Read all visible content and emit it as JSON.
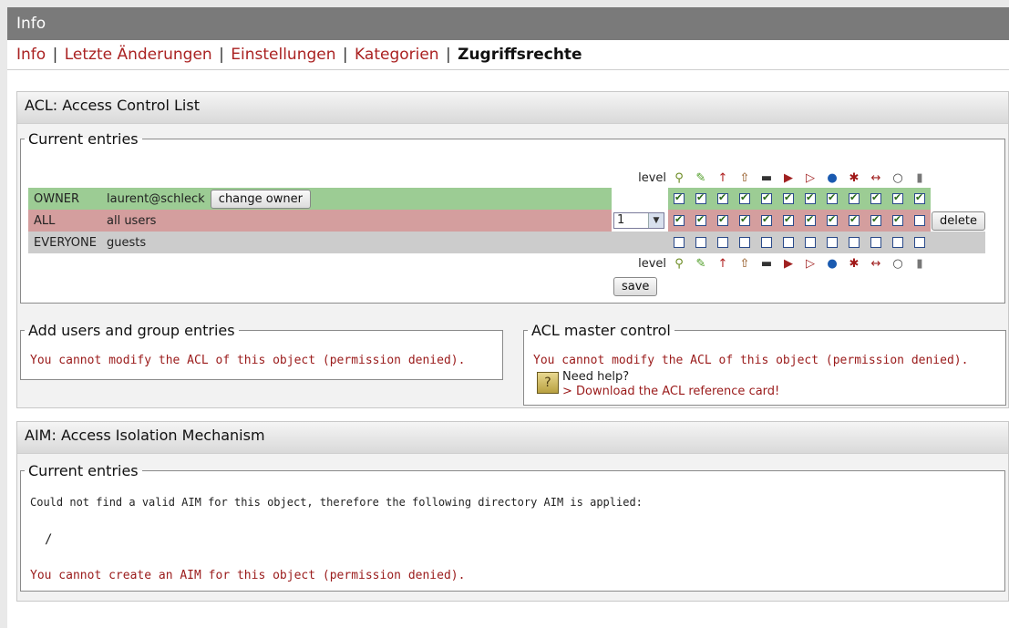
{
  "topbar": {
    "title": "Info"
  },
  "tabs": [
    {
      "label": "Info"
    },
    {
      "label": "Letzte Änderungen"
    },
    {
      "label": "Einstellungen"
    },
    {
      "label": "Kategorien"
    },
    {
      "label": "Zugriffsrechte",
      "active": true
    }
  ],
  "acl": {
    "title": "ACL: Access Control List",
    "current_legend": "Current entries",
    "level_label": "level",
    "permission_icons": [
      "key-icon",
      "pencil-icon",
      "arrow-up-icon",
      "upload-icon",
      "folder-icon",
      "folder-in-icon",
      "folder-out-icon",
      "info-icon",
      "gear-icon",
      "double-arrow-icon",
      "speech-bubble-icon",
      "trash-icon"
    ],
    "rows": [
      {
        "type": "OWNER",
        "who": "laurent@schleck",
        "button": "change owner",
        "checks": [
          1,
          1,
          1,
          1,
          1,
          1,
          1,
          1,
          1,
          1,
          1,
          1
        ],
        "level": ""
      },
      {
        "type": "ALL",
        "who": "all users",
        "level": "1",
        "checks": [
          1,
          1,
          1,
          1,
          1,
          1,
          1,
          1,
          1,
          1,
          1,
          0
        ],
        "button": "delete"
      },
      {
        "type": "EVERYONE",
        "who": "guests",
        "checks": [
          0,
          0,
          0,
          0,
          0,
          0,
          0,
          0,
          0,
          0,
          0,
          0
        ]
      }
    ],
    "save_label": "save",
    "add_legend": "Add users and group entries",
    "add_denied": "You cannot modify the ACL of this object (permission denied).",
    "master_legend": "ACL master control",
    "master_denied": "You cannot modify the ACL of this object (permission denied).",
    "help_text": "Need help?",
    "help_link": "> Download the ACL reference card!"
  },
  "aim": {
    "title": "AIM: Access Isolation Mechanism",
    "current_legend": "Current entries",
    "info": "Could not find a valid AIM for this object, therefore the following directory AIM is applied:",
    "path": "/",
    "denied": "You cannot create an AIM for this object (permission denied)."
  },
  "colors": {
    "owner": "#9ccc94",
    "all": "#d49e9e",
    "everyone": "#cccccc",
    "link": "#a22"
  }
}
